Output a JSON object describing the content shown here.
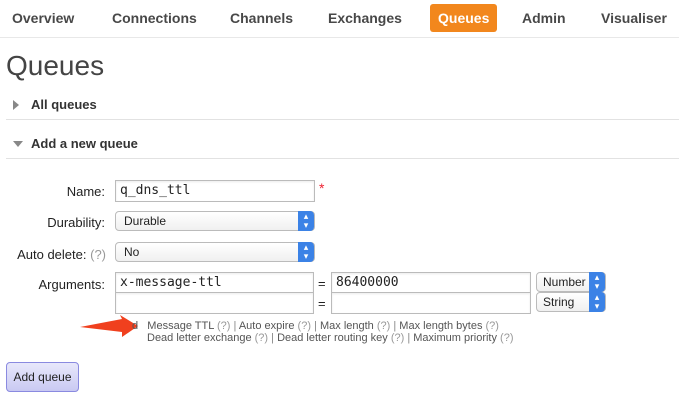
{
  "nav": {
    "tabs": [
      {
        "label": "Overview"
      },
      {
        "label": "Connections"
      },
      {
        "label": "Channels"
      },
      {
        "label": "Exchanges"
      },
      {
        "label": "Queues",
        "active": true
      },
      {
        "label": "Admin"
      },
      {
        "label": "Visualiser"
      }
    ],
    "active_color": "#f2871d"
  },
  "page_title": "Queues",
  "sections": {
    "all_queues": "All queues",
    "add_queue": "Add a new queue"
  },
  "form": {
    "name_label": "Name:",
    "name_value": "q_dns_ttl",
    "required_mark": "*",
    "durability_label": "Durability:",
    "durability_value": "Durable",
    "auto_delete_label": "Auto delete:",
    "auto_delete_help": "(?)",
    "auto_delete_value": "No",
    "arguments_label": "Arguments:",
    "arguments": [
      {
        "key": "x-message-ttl",
        "value": "86400000",
        "type": "Number"
      },
      {
        "key": "",
        "value": "",
        "type": "String"
      }
    ],
    "equals": "="
  },
  "hints": {
    "prefix": "d",
    "line1": [
      {
        "label": "Message TTL",
        "help": "(?)"
      },
      {
        "label": "Auto expire",
        "help": "(?)"
      },
      {
        "label": "Max length",
        "help": "(?)"
      },
      {
        "label": "Max length bytes",
        "help": "(?)"
      }
    ],
    "line2": [
      {
        "label": "Dead letter exchange",
        "help": "(?)"
      },
      {
        "label": "Dead letter routing key",
        "help": "(?)"
      },
      {
        "label": "Maximum priority",
        "help": "(?)"
      }
    ],
    "separator": "|"
  },
  "add_button": "Add queue",
  "annotation_color": "#f0401e"
}
